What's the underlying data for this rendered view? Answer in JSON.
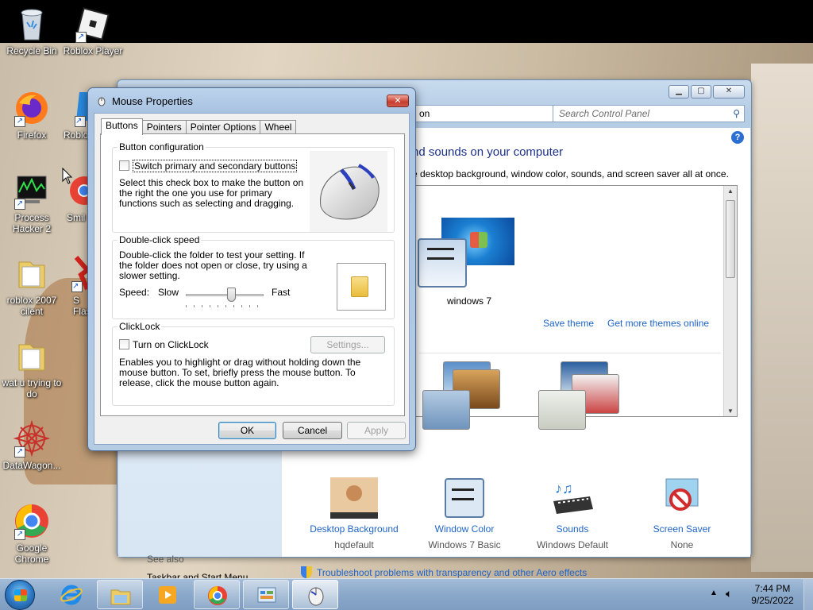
{
  "desktop": {
    "icons": [
      {
        "label": "Recycle Bin"
      },
      {
        "label": "Roblox Player"
      },
      {
        "label": "Firefox"
      },
      {
        "label": "Roblo"
      },
      {
        "label": "Process Hacker 2"
      },
      {
        "label": "Smil"
      },
      {
        "label": "roblox 2007 cilent"
      },
      {
        "label": "S Flash"
      },
      {
        "label": "wat u trying to do"
      },
      {
        "label": "DataWagon..."
      },
      {
        "label": "Google Chrome"
      }
    ]
  },
  "control_panel": {
    "address_text": "on",
    "search_placeholder": "Search Control Panel",
    "heading": "nd sounds on your computer",
    "subheading": "e desktop background, window color, sounds, and screen saver all at once.",
    "theme_name": "windows 7",
    "save_theme": "Save theme",
    "get_more_themes": "Get more themes online",
    "bottom_items": [
      {
        "link": "Desktop Background",
        "value": "hqdefault",
        "icon": "desktop-background-icon"
      },
      {
        "link": "Window Color",
        "value": "Windows 7 Basic",
        "icon": "window-color-icon"
      },
      {
        "link": "Sounds",
        "value": "Windows Default",
        "icon": "sounds-icon"
      },
      {
        "link": "Screen Saver",
        "value": "None",
        "icon": "screen-saver-icon"
      }
    ],
    "see_also": "See also",
    "taskbar_link": "Taskbar and Start Menu",
    "troubleshoot": "Troubleshoot problems with transparency and other Aero effects"
  },
  "dialog": {
    "title": "Mouse Properties",
    "tabs": [
      "Buttons",
      "Pointers",
      "Pointer Options",
      "Wheel"
    ],
    "active_tab": "Buttons",
    "button_config": {
      "label": "Button configuration",
      "checkbox": "Switch primary and secondary buttons",
      "checked": false,
      "description": "Select this check box to make the button on the right the one you use for primary functions such as selecting and dragging."
    },
    "double_click": {
      "label": "Double-click speed",
      "description": "Double-click the folder to test your setting. If the folder does not open or close, try using a slower setting.",
      "speed_label": "Speed:",
      "slow": "Slow",
      "fast": "Fast",
      "slider_value": 0.6
    },
    "clicklock": {
      "label": "ClickLock",
      "checkbox": "Turn on ClickLock",
      "checked": false,
      "settings_button": "Settings...",
      "description": "Enables you to highlight or drag without holding down the mouse button. To set, briefly press the mouse button. To release, click the mouse button again."
    },
    "ok": "OK",
    "cancel": "Cancel",
    "apply": "Apply"
  },
  "taskbar": {
    "time": "7:44 PM",
    "date": "9/25/2022",
    "items": [
      "internet-explorer-icon",
      "windows-explorer-icon",
      "media-player-icon",
      "chrome-icon",
      "control-panel-icon",
      "mouse-icon"
    ]
  },
  "colors": {
    "link": "#1e64c8",
    "heading": "#1e3287",
    "taskbar": "#8aa8c9"
  }
}
